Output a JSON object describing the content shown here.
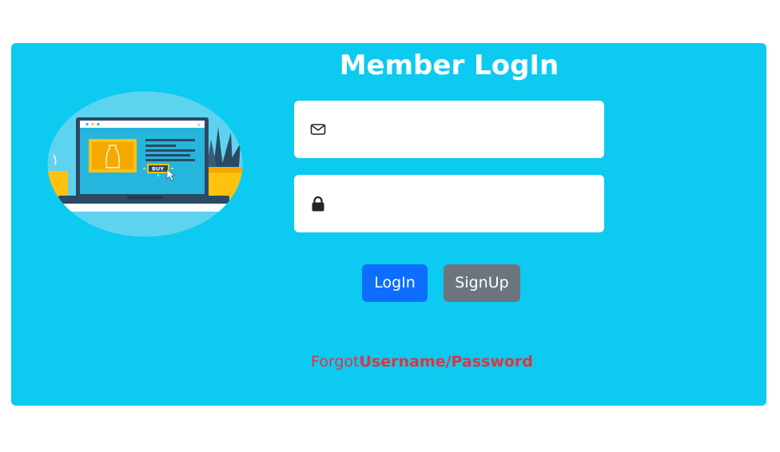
{
  "header": {
    "title": "Member LogIn"
  },
  "form": {
    "email_icon": "envelope-icon",
    "email_value": "",
    "email_placeholder": "",
    "password_icon": "lock-icon",
    "password_value": "",
    "password_placeholder": ""
  },
  "actions": {
    "login_label": "LogIn",
    "signup_label": "SignUp"
  },
  "forgot": {
    "prefix": "Forgot",
    "link_text": "Username/Password"
  },
  "illustration": {
    "buy_label": "BUY"
  },
  "colors": {
    "card_bg": "#0dcaf0",
    "login_btn": "#0d6efd",
    "signup_btn": "#6c757d",
    "forgot_text": "#dc3545"
  }
}
